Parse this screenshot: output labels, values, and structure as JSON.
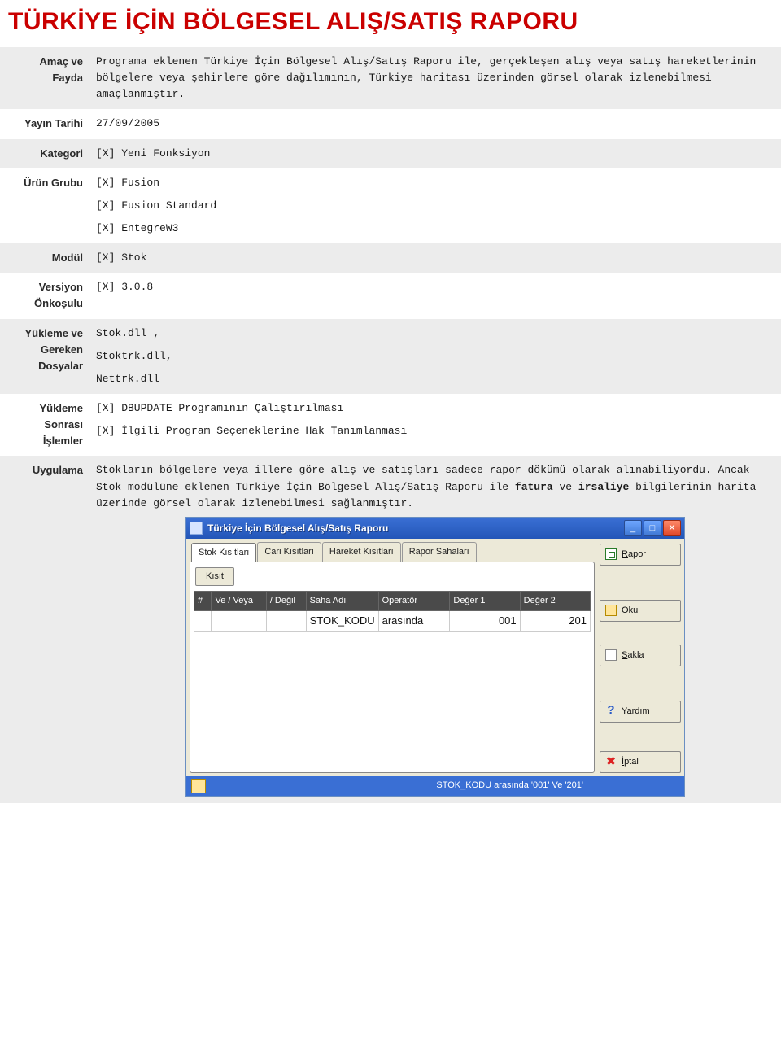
{
  "page_title": "TÜRKİYE İÇİN BÖLGESEL ALIŞ/SATIŞ RAPORU",
  "rows": {
    "amac": {
      "label": "Amaç ve Fayda",
      "text": "Programa eklenen Türkiye İçin Bölgesel Alış/Satış Raporu ile, gerçekleşen alış veya satış hareketlerinin bölgelere veya şehirlere göre dağılımının, Türkiye haritası üzerinden görsel olarak izlenebilmesi amaçlanmıştır."
    },
    "yayin": {
      "label": "Yayın Tarihi",
      "text": "27/09/2005"
    },
    "kategori": {
      "label": "Kategori",
      "text": "[X] Yeni Fonksiyon"
    },
    "urun": {
      "label": "Ürün Grubu",
      "lines": [
        "[X] Fusion",
        "[X] Fusion Standard",
        "[X] EntegreW3"
      ]
    },
    "modul": {
      "label": "Modül",
      "text": "[X] Stok"
    },
    "versiyon": {
      "label": "Versiyon Önkoşulu",
      "text": "[X] 3.0.8"
    },
    "dosyalar": {
      "label": "Yükleme ve Gereken Dosyalar",
      "lines": [
        "Stok.dll ,",
        "Stoktrk.dll,",
        "Nettrk.dll"
      ]
    },
    "sonrasi": {
      "label": "Yükleme Sonrası İşlemler",
      "lines": [
        "[X] DBUPDATE Programının Çalıştırılması",
        "[X] İlgili Program Seçeneklerine Hak Tanımlanması"
      ]
    },
    "uygulama": {
      "label": "Uygulama",
      "text_pre": "Stokların bölgelere veya illere göre alış ve satışları sadece rapor dökümü olarak alınabiliyordu. Ancak Stok modülüne eklenen Türkiye İçin Bölgesel Alış/Satış Raporu ile ",
      "bold1": "fatura",
      "mid": " ve ",
      "bold2": "irsaliye",
      "text_post": " bilgilerinin harita üzerinde görsel olarak izlenebilmesi sağlanmıştır."
    }
  },
  "window": {
    "title": "Türkiye İçin Bölgesel Alış/Satış Raporu",
    "tabs": [
      "Stok Kısıtları",
      "Cari Kısıtları",
      "Hareket Kısıtları",
      "Rapor Sahaları"
    ],
    "kisit_btn": "Kısıt",
    "crit_headers": [
      "#",
      "Ve / Veya",
      "/ Değil",
      "Saha Adı",
      "Operatör",
      "Değer 1",
      "Değer 2"
    ],
    "crit_row": {
      "num": "",
      "veveya": "",
      "degil": "",
      "saha": "STOK_KODU",
      "op": "arasında",
      "d1": "001",
      "d2": "201"
    },
    "side": {
      "rapor": "Rapor",
      "oku": "Oku",
      "sakla": "Sakla",
      "yardim": "Yardım",
      "iptal": "İptal"
    },
    "status": "STOK_KODU arasında '001' Ve '201'"
  }
}
